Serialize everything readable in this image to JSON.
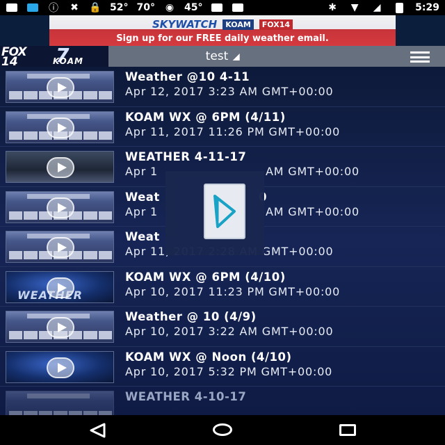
{
  "status_bar": {
    "temp_1": "52°",
    "temp_2": "70°",
    "temp_3": "45°",
    "time": "5:29"
  },
  "ad": {
    "skywatch": "SKYWATCH",
    "badge_koam": "KOAM",
    "badge_fox": "FOX14",
    "tagline": "Sign up for our FREE daily weather email."
  },
  "header": {
    "logo_fox": "FOX",
    "logo_num": "14",
    "logo_channel": "7",
    "logo_koam": "KOAM",
    "title": "test"
  },
  "videos": [
    {
      "title": "Weather @10 4-11",
      "date": "Apr 12, 2017 3:23 AM GMT+00:00",
      "thumb": "forecast"
    },
    {
      "title": "KOAM WX @ 6PM (4/11)",
      "date": "Apr 11, 2017 11:26 PM GMT+00:00",
      "thumb": "forecast"
    },
    {
      "title": "WEATHER 4-11-17",
      "date": "Apr 1",
      "date_tail": "AM GMT+00:00",
      "thumb": "studio"
    },
    {
      "title": "Weat",
      "title_tail": "0",
      "date": "Apr 1",
      "date_tail": "AM GMT+00:00",
      "thumb": "forecast"
    },
    {
      "title": "Weat",
      "date": "Apr 11, 2017 2:28 AM GMT+00:00",
      "thumb": "forecast"
    },
    {
      "title": "KOAM WX @ 6PM (4/10)",
      "date": "Apr 10, 2017 11:23 PM GMT+00:00",
      "thumb": "weather-logo",
      "thumb_word": "WEATHER"
    },
    {
      "title": "Weather @ 10 (4/9)",
      "date": "Apr 10, 2017 3:22 AM GMT+00:00",
      "thumb": "forecast"
    },
    {
      "title": "KOAM WX @ Noon (4/10)",
      "date": "Apr 10, 2017 5:32 PM GMT+00:00",
      "thumb": "weather-logo"
    },
    {
      "title": "WEATHER 4-10-17",
      "date": "",
      "thumb": "forecast"
    }
  ],
  "icons": {
    "loading": "app-loading-icon",
    "menu": "hamburger-menu-icon",
    "play": "play-icon"
  }
}
